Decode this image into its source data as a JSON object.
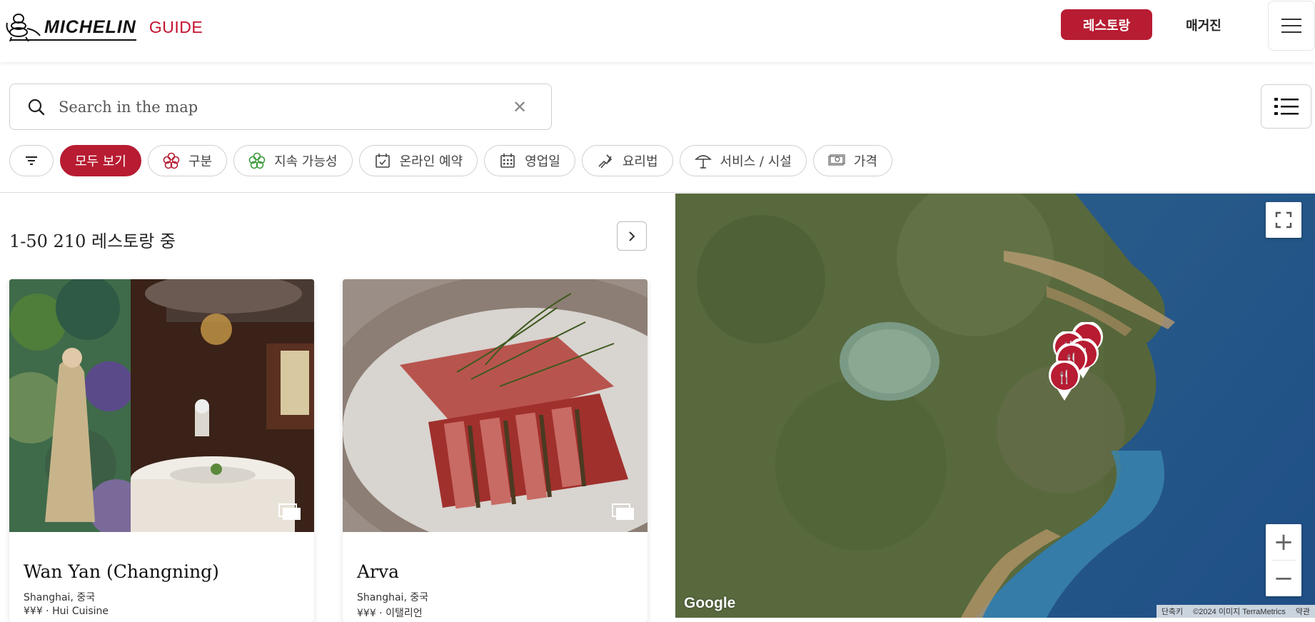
{
  "header": {
    "logo_text": "MICHELIN",
    "logo_guide": "GUIDE",
    "restaurants_label": "레스토랑",
    "magazine_label": "매거진"
  },
  "search": {
    "placeholder": "Search in the map",
    "value": ""
  },
  "filters": [
    {
      "label": "모두 보기",
      "active": true
    },
    {
      "label": "구분",
      "icon": "michelin-flower-icon"
    },
    {
      "label": "지속 가능성",
      "icon": "green-clover-icon"
    },
    {
      "label": "온라인 예약",
      "icon": "calendar-check-icon"
    },
    {
      "label": "영업일",
      "icon": "calendar-grid-icon"
    },
    {
      "label": "요리법",
      "icon": "cuisine-hand-icon"
    },
    {
      "label": "서비스 / 시설",
      "icon": "service-umbrella-icon"
    },
    {
      "label": "가격",
      "icon": "price-banknote-icon"
    }
  ],
  "results": {
    "count_text": "1-50 210 레스토랑 중"
  },
  "cards": [
    {
      "title": "Wan Yan (Changning)",
      "location": "Shanghai, 중국",
      "meta": "¥¥¥ · Hui Cuisine"
    },
    {
      "title": "Arva",
      "location": "Shanghai, 중국",
      "meta": "¥¥¥ · 이탤리언"
    }
  ],
  "map": {
    "google_label": "Google",
    "attribution": [
      "단축키",
      "©2024 이미지 TerraMetrics",
      "약관"
    ],
    "brand_color": "#b71c32"
  }
}
